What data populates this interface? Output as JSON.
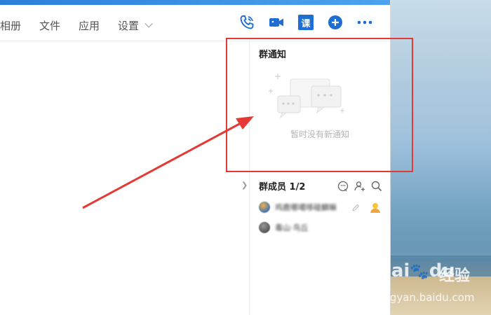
{
  "tabs": [
    {
      "label": "相册"
    },
    {
      "label": "文件"
    },
    {
      "label": "应用"
    },
    {
      "label": "设置"
    }
  ],
  "toolbar": {
    "course_label": "课",
    "icons": [
      "phone-icon",
      "video-call-icon",
      "course-icon",
      "add-circle-icon",
      "more-icon"
    ]
  },
  "notice": {
    "title": "群通知",
    "empty_text": "暂时没有新通知"
  },
  "members": {
    "title": "群成员 1/2",
    "list": [
      {
        "name": "鸡鹿哪噶哆碰麟嘛"
      },
      {
        "name": "毒山·鸟丘"
      }
    ]
  },
  "watermark": {
    "brand": "Bai",
    "brand2": "du",
    "jingyan": "经验",
    "url": "jingyan.baidu.com"
  },
  "colors": {
    "accent": "#1f6ed4",
    "annotation_red": "#e53935"
  }
}
